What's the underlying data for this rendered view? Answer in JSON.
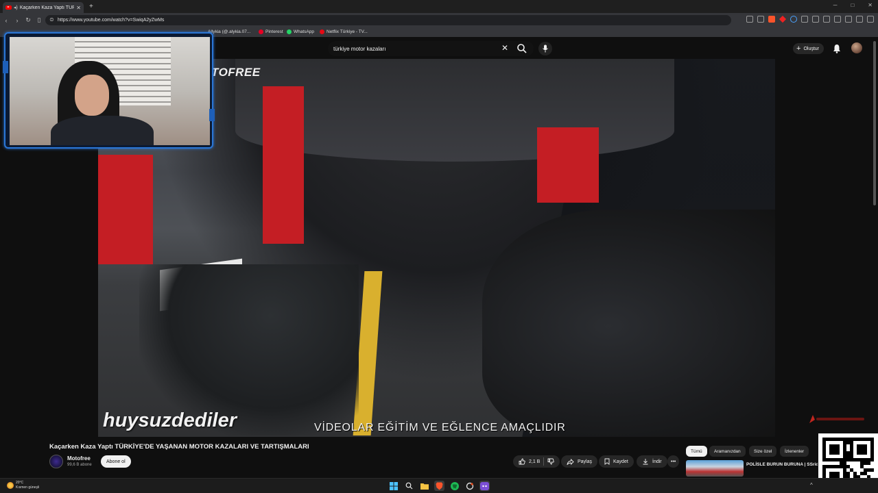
{
  "browser": {
    "tab_title": "Kaçarken Kaza Yaptı TÜRKİYE",
    "new_tab": "+",
    "url": "https://www.youtube.com/watch?v=SwiqA2yZwMs",
    "bookmarks": [
      {
        "label": "Allykia (@.alykia.07...",
        "color": "#e6e6e6"
      },
      {
        "label": "Pinterest",
        "color": "#e60023"
      },
      {
        "label": "WhatsApp",
        "color": "#25d366"
      },
      {
        "label": "Netflix Türkiye - TV...",
        "color": "#e50914"
      }
    ]
  },
  "masthead": {
    "search_value": "türkiye motor kazaları",
    "create_label": "Oluştur"
  },
  "video": {
    "overlay_top": "TOFREE",
    "overlay_name": "huysuzdediler",
    "overlay_caption": "VİDEOLAR EĞİTİM VE EĞLENCE AMAÇLIDIR",
    "title": "Kaçarken Kaza Yaptı TÜRKİYE'DE YAŞANAN MOTOR KAZALARI VE TARTIŞMALARI"
  },
  "channel": {
    "name": "Motofree",
    "subscribers": "99,6 B abone",
    "subscribe_label": "Abone ol"
  },
  "actions": {
    "likes": "2,1 B",
    "share": "Paylaş",
    "save": "Kaydet",
    "download": "İndir"
  },
  "chips": [
    "Tümü",
    "Aramanızdan",
    "Size özel",
    "İzlenenler"
  ],
  "recommended": {
    "title": "POLİSLE BURUN BURUNA | SSriders | Motosiklet Kazaları ..."
  },
  "taskbar": {
    "temp": "20°C",
    "condition": "Kısmen güneşli"
  },
  "colors": {
    "accent_red": "#ff0000",
    "cam_border": "#2a76d6",
    "background": "#0f0f0f"
  }
}
